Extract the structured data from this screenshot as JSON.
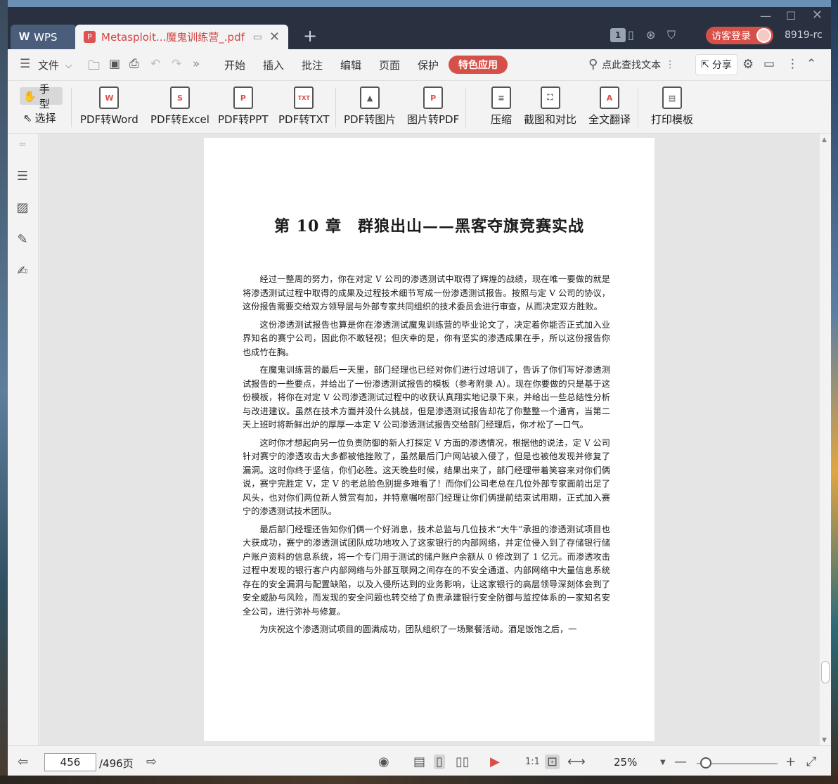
{
  "app": {
    "brand": "WPS",
    "user_id": "8919-rc",
    "login_label": "访客登录",
    "page_badge": "1"
  },
  "tab": {
    "title": "Metasploit...魔鬼训练营_.pdf"
  },
  "menu": {
    "file": "文件",
    "items": [
      "开始",
      "插入",
      "批注",
      "编辑",
      "页面",
      "保护"
    ],
    "special": "特色应用",
    "search": "点此查找文本",
    "share": "分享"
  },
  "modes": {
    "hand": "手型",
    "select": "选择"
  },
  "tools": [
    {
      "label": "PDF转Word",
      "icon": "pdf-to-word-icon",
      "glyph": "W"
    },
    {
      "label": "PDF转Excel",
      "icon": "pdf-to-excel-icon",
      "glyph": "S"
    },
    {
      "label": "PDF转PPT",
      "icon": "pdf-to-ppt-icon",
      "glyph": "P"
    },
    {
      "label": "PDF转TXT",
      "icon": "pdf-to-txt-icon",
      "glyph": "TXT"
    },
    {
      "label": "PDF转图片",
      "icon": "pdf-to-image-icon",
      "glyph": "▲"
    },
    {
      "label": "图片转PDF",
      "icon": "image-to-pdf-icon",
      "glyph": "P"
    },
    {
      "label": "压缩",
      "icon": "compress-icon",
      "glyph": "≡"
    },
    {
      "label": "截图和对比",
      "icon": "screenshot-compare-icon",
      "glyph": "⛶"
    },
    {
      "label": "全文翻译",
      "icon": "translate-icon",
      "glyph": "A"
    },
    {
      "label": "打印模板",
      "icon": "print-template-icon",
      "glyph": "▤"
    }
  ],
  "document": {
    "chapter_title": "第 10 章　群狼出山——黑客夺旗竞赛实战",
    "paragraphs": [
      "经过一整周的努力，你在对定 V 公司的渗透测试中取得了辉煌的战绩，现在唯一要做的就是将渗透测试过程中取得的成果及过程技术细节写成一份渗透测试报告。按照与定 V 公司的协议，这份报告需要交给双方领导层与外部专家共同组织的技术委员会进行审查，从而决定双方胜败。",
      "这份渗透测试报告也算是你在渗透测试魔鬼训练营的毕业论文了，决定着你能否正式加入业界知名的赛宁公司，因此你不敢轻视；但庆幸的是，你有坚实的渗透成果在手，所以这份报告你也成竹在胸。",
      "在魔鬼训练营的最后一天里，部门经理也已经对你们进行过培训了，告诉了你们写好渗透测试报告的一些要点，并给出了一份渗透测试报告的模板（参考附录 A）。现在你要做的只是基于这份模板，将你在对定 V 公司渗透测试过程中的收获认真翔实地记录下来，并给出一些总结性分析与改进建议。虽然在技术方面并没什么挑战，但是渗透测试报告却花了你整整一个通宵，当第二天上班时将新鲜出炉的厚厚一本定 V 公司渗透测试报告交给部门经理后，你才松了一口气。",
      "这时你才想起向另一位负责防御的新人打探定 V 方面的渗透情况，根据他的说法，定 V 公司针对赛宁的渗透攻击大多都被他挫败了，虽然最后门户网站被入侵了，但是也被他发现并修复了漏洞。这时你终于坚信，你们必胜。这天晚些时候，结果出来了，部门经理带着笑容来对你们俩说，赛宁完胜定 V，定 V 的老总脸色别提多难看了！而你们公司老总在几位外部专家面前出足了风头，也对你们两位新人赞赏有加，并特意嘱咐部门经理让你们俩提前结束试用期，正式加入赛宁的渗透测试技术团队。",
      "最后部门经理还告知你们俩一个好消息，技术总监与几位技术“大牛”承担的渗透测试项目也大获成功，赛宁的渗透测试团队成功地攻入了这家银行的内部网络，并定位侵入到了存储银行储户账户资料的信息系统，将一个专门用于测试的储户账户余额从 0 修改到了 1 亿元。而渗透攻击过程中发现的银行客户内部网络与外部互联网之间存在的不安全通道、内部网络中大量信息系统存在的安全漏洞与配置缺陷，以及入侵所达到的业务影响，让这家银行的高层领导深刻体会到了安全威胁与风险，而发现的安全问题也转交给了负责承建银行安全防御与监控体系的一家知名安全公司，进行弥补与修复。",
      "为庆祝这个渗透测试项目的圆满成功，团队组织了一场聚餐活动。酒足饭饱之后，一"
    ]
  },
  "status": {
    "current_page": "456",
    "total_pages": "/496页",
    "zoom": "25%"
  },
  "colors": {
    "accent": "#d6504a",
    "titlebar": "#293140"
  }
}
